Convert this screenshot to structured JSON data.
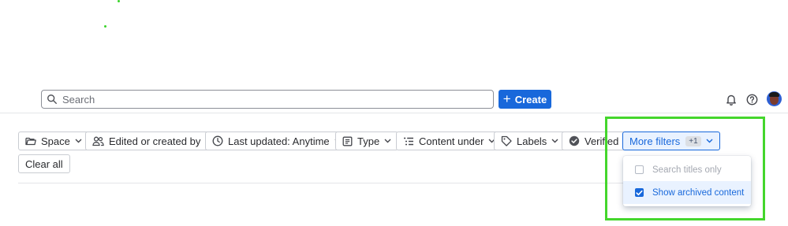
{
  "header": {
    "search_placeholder": "Search",
    "create_label": "Create",
    "plus_glyph": "+",
    "icons": [
      "bell-icon",
      "help-icon"
    ]
  },
  "filters": {
    "space": "Space",
    "edited_by": "Edited or created by",
    "last_updated": "Last updated: Anytime",
    "type": "Type",
    "content_under": "Content under",
    "labels": "Labels",
    "verified": "Verified",
    "more_filters": "More filters",
    "more_filters_badge": "+1",
    "clear_all": "Clear all"
  },
  "dropdown": {
    "options": [
      {
        "label": "Search titles only",
        "checked": false
      },
      {
        "label": "Show archived content",
        "checked": true
      }
    ]
  },
  "colors": {
    "primary": "#1868db",
    "highlight": "#44d62c",
    "selected_bg": "#e9f2ff"
  }
}
